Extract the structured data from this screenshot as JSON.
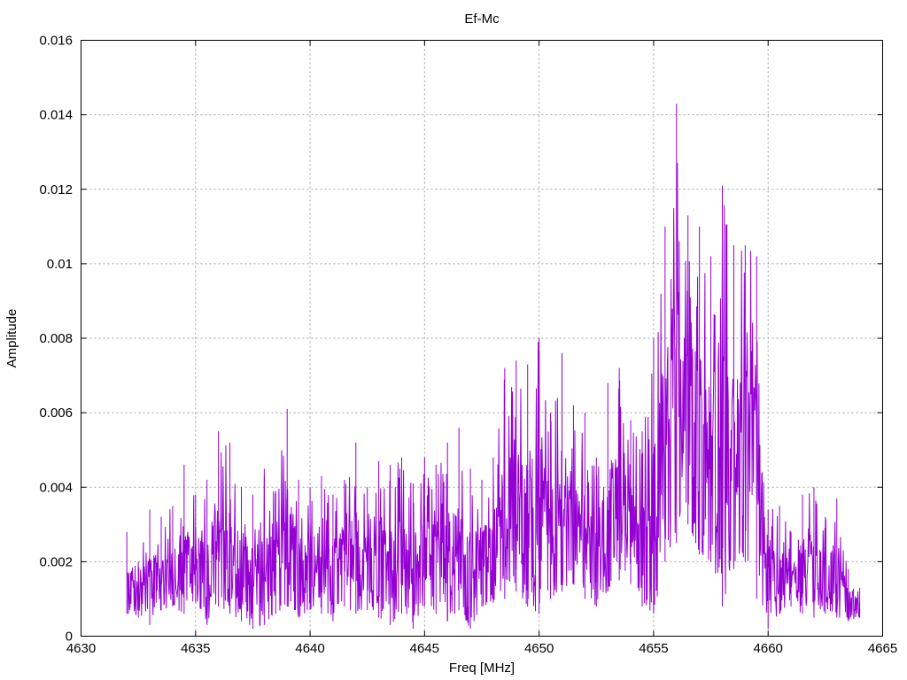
{
  "chart_data": {
    "type": "line",
    "title": "Ef-Mc",
    "xlabel": "Freq [MHz]",
    "ylabel": "Amplitude",
    "xlim": [
      4630,
      4665
    ],
    "ylim": [
      0,
      0.016
    ],
    "xticks": [
      "4630",
      "4635",
      "4640",
      "4645",
      "4650",
      "4655",
      "4660",
      "4665"
    ],
    "yticks": [
      "0",
      "0.002",
      "0.004",
      "0.006",
      "0.008",
      "0.01",
      "0.012",
      "0.014",
      "0.016"
    ],
    "grid": true,
    "color": "#9400d3",
    "series": [
      {
        "x": [
          4632.0,
          4632.5,
          4633.0,
          4633.5,
          4634.0,
          4634.5,
          4635.0,
          4635.5,
          4636.0,
          4636.5,
          4637.0,
          4637.5,
          4638.0,
          4638.5,
          4639.0,
          4639.5,
          4640.0,
          4640.5,
          4641.0,
          4641.5,
          4642.0,
          4642.5,
          4643.0,
          4643.5,
          4644.0,
          4644.5,
          4645.0,
          4645.5,
          4646.0,
          4646.5,
          4647.0,
          4647.5,
          4648.0,
          4648.5,
          4649.0,
          4649.5,
          4650.0,
          4650.5,
          4651.0,
          4651.5,
          4652.0,
          4652.5,
          4653.0,
          4653.5,
          4654.0,
          4654.5,
          4655.0,
          4655.5,
          4656.0,
          4656.5,
          4657.0,
          4657.5,
          4658.0,
          4658.5,
          4659.0,
          4659.5,
          4660.0,
          4660.5,
          4661.0,
          4661.5,
          4662.0,
          4662.5,
          4663.0,
          4663.5,
          4664.0
        ],
        "min": [
          0.0006,
          0.0005,
          0.0003,
          0.0007,
          0.0008,
          0.0006,
          0.0009,
          0.0003,
          0.0008,
          0.0006,
          0.0004,
          0.0002,
          0.0003,
          0.0006,
          0.0008,
          0.0005,
          0.0007,
          0.0006,
          0.0004,
          0.0008,
          0.0006,
          0.0007,
          0.0005,
          0.0003,
          0.0006,
          0.0002,
          0.0008,
          0.0006,
          0.0004,
          0.0007,
          0.0002,
          0.0008,
          0.0009,
          0.001,
          0.0012,
          0.0008,
          0.0006,
          0.001,
          0.0012,
          0.0014,
          0.001,
          0.0008,
          0.0012,
          0.0015,
          0.0014,
          0.0008,
          0.0006,
          0.002,
          0.0025,
          0.003,
          0.0022,
          0.002,
          0.0008,
          0.0018,
          0.002,
          0.001,
          0.0002,
          0.0006,
          0.0008,
          0.0006,
          0.0005,
          0.0006,
          0.0005,
          0.0004,
          0.0005
        ],
        "max": [
          0.0028,
          0.002,
          0.0034,
          0.0032,
          0.0035,
          0.0046,
          0.0038,
          0.0042,
          0.0055,
          0.0052,
          0.004,
          0.0038,
          0.0045,
          0.0039,
          0.0061,
          0.0042,
          0.004,
          0.0043,
          0.0038,
          0.0042,
          0.0052,
          0.004,
          0.0047,
          0.0046,
          0.0048,
          0.0041,
          0.0048,
          0.0046,
          0.0052,
          0.0056,
          0.0045,
          0.0042,
          0.0048,
          0.0072,
          0.0074,
          0.0073,
          0.008,
          0.006,
          0.0076,
          0.0062,
          0.006,
          0.0048,
          0.0068,
          0.0072,
          0.0058,
          0.0055,
          0.008,
          0.011,
          0.0143,
          0.0113,
          0.011,
          0.0102,
          0.0121,
          0.0105,
          0.0105,
          0.0102,
          0.0034,
          0.0035,
          0.0028,
          0.0038,
          0.004,
          0.0032,
          0.0037,
          0.0018,
          0.0013
        ]
      }
    ]
  }
}
